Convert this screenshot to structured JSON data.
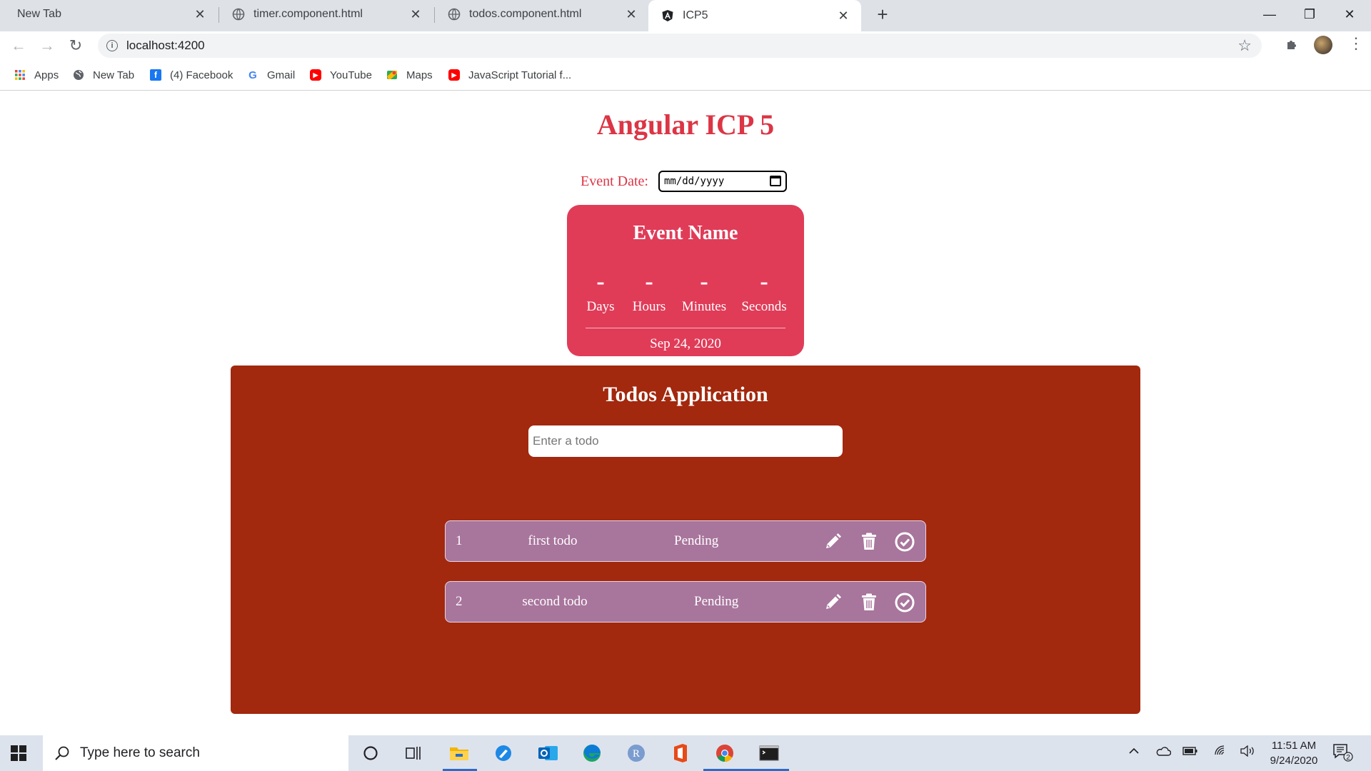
{
  "browser": {
    "tabs": [
      {
        "label": "New Tab",
        "active": false
      },
      {
        "label": "timer.component.html",
        "active": false
      },
      {
        "label": "todos.component.html",
        "active": false
      },
      {
        "label": "ICP5",
        "active": true
      }
    ],
    "url": "localhost:4200",
    "bookmarks": [
      {
        "label": "Apps",
        "icon": "apps-grid-icon"
      },
      {
        "label": "New Tab",
        "icon": "globe-icon"
      },
      {
        "label": "(4) Facebook",
        "icon": "facebook-icon"
      },
      {
        "label": "Gmail",
        "icon": "google-icon"
      },
      {
        "label": "YouTube",
        "icon": "youtube-icon"
      },
      {
        "label": "Maps",
        "icon": "maps-icon"
      },
      {
        "label": "JavaScript Tutorial f...",
        "icon": "youtube-icon"
      }
    ]
  },
  "page": {
    "title": "Angular ICP 5",
    "event_date_label": "Event Date:",
    "event_date_placeholder": "mm/dd/yyyy",
    "timer": {
      "event_name": "Event Name",
      "units": [
        {
          "value": "-",
          "label": "Days"
        },
        {
          "value": "-",
          "label": "Hours"
        },
        {
          "value": "-",
          "label": "Minutes"
        },
        {
          "value": "-",
          "label": "Seconds"
        }
      ],
      "date": "Sep 24, 2020"
    },
    "todos": {
      "title": "Todos Application",
      "input_placeholder": "Enter a todo",
      "items": [
        {
          "index": "1",
          "text": "first todo",
          "status": "Pending"
        },
        {
          "index": "2",
          "text": "second todo",
          "status": "Pending"
        }
      ]
    }
  },
  "taskbar": {
    "search_placeholder": "Type here to search",
    "time": "11:51 AM",
    "date": "9/24/2020",
    "notification_count": "2"
  },
  "colors": {
    "accent_red": "#dc3545",
    "timer_card": "#e03c58",
    "todo_panel": "#a2280e",
    "todo_row": "#a8759c"
  }
}
